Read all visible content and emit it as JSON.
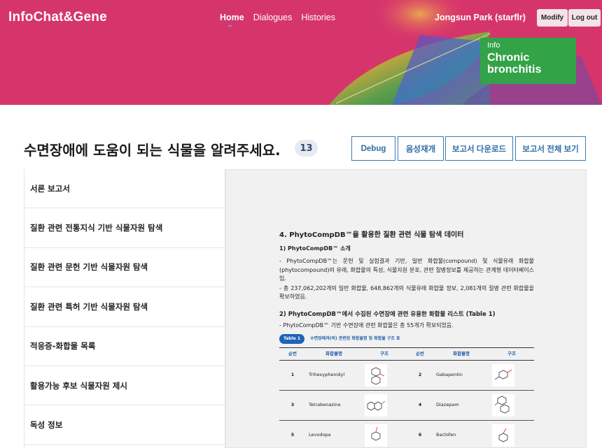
{
  "header": {
    "logo": "InfoChat&Gene",
    "nav": [
      {
        "label": "Home",
        "active": true
      },
      {
        "label": "Dialogues",
        "active": false
      },
      {
        "label": "Histories",
        "active": false
      }
    ],
    "user": "Jongsun Park (starflr)",
    "modify_label": "Modify",
    "logout_label": "Log out",
    "info_card": {
      "label": "Info",
      "title": "Chronic bronchitis"
    },
    "colors": {
      "hero": "#d6356b",
      "info_card": "#33a347"
    }
  },
  "main": {
    "title": "수면장애에 도움이 되는 식물을 알려주세요.",
    "count": "13",
    "buttons": [
      "Debug",
      "음성재개",
      "보고서 다운로드",
      "보고서 전체 보기"
    ]
  },
  "sidebar": {
    "items": [
      "서론 보고서",
      "질환 관련 전통지식 기반 식물자원 탐색",
      "질환 관련 문헌 기반 식물자원 탐색",
      "질환 관련 특허 기반 식물자원 탐색",
      "적응증-화합물 목록",
      "활용가능 후보 식물자원 제시",
      "독성 정보"
    ]
  },
  "document": {
    "heading": "4. PhytoCompDB™을 활용한 질환 관련 식물 탐색 데이터",
    "sub1": "1) PhytoCompDB™ 소개",
    "para1": "- PhytoCompDB™는 문헌 및 실험결과 기반, 일반 화합물(compound) 및 식물유래 화합물(phytocompound)의 유래, 화합물의 특성, 식물자원 분포, 관련 질병정보를 제공하는 관계형 데이터베이스임.",
    "para2": "- 총 237,062,202개의 일반 화합물, 648,862개의 식물유래 화합물 정보, 2,081개의 질병 관련 화합물을 확보하였음.",
    "sub2": "2) PhytoCompDB™에서 수집된 수면장애 관련 유용한 화합물 리스트 (Table 1)",
    "para3": "- PhytoCompDB™ 기반 수면장애 관련 화합물은 총 55개가 확보되었음.",
    "table_badge": "Table 1",
    "table_caption": "수면장애과(의) 관련된 화합물명 및 화합물 구조 표",
    "table_headers": [
      "순번",
      "화합물명",
      "구조",
      "순번",
      "화합물명",
      "구조"
    ],
    "rows": [
      {
        "no1": "1",
        "name1": "Trihexyphenidyl",
        "no2": "2",
        "name2": "Gabapentin"
      },
      {
        "no1": "3",
        "name1": "Tetrabenazine",
        "no2": "4",
        "name2": "Diazepam"
      },
      {
        "no1": "5",
        "name1": "Levodopa",
        "no2": "6",
        "name2": "Baclofen"
      }
    ]
  }
}
